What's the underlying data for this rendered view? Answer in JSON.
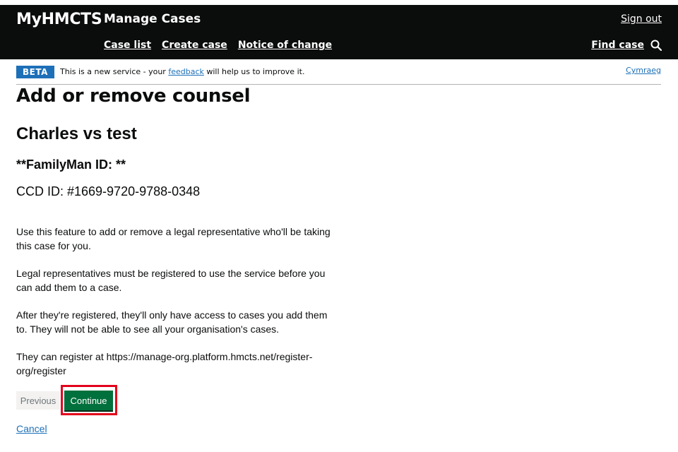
{
  "header": {
    "brand": "MyHMCTS",
    "service_name": "Manage Cases",
    "sign_out": "Sign out",
    "nav": [
      {
        "label": "Case list"
      },
      {
        "label": "Create case"
      },
      {
        "label": "Notice of change"
      }
    ],
    "find_case": "Find case",
    "find_case_icon": "search-icon"
  },
  "phase_banner": {
    "tag": "BETA",
    "text_before": "This is a new service - your ",
    "link": "feedback",
    "text_after": " will help us to improve it.",
    "language_link": "Cymraeg"
  },
  "main": {
    "title": "Add or remove counsel",
    "case_name": "Charles vs test",
    "familyman_id": "**FamilyMan ID: **",
    "ccd_id": "CCD ID: #1669-9720-9788-0348",
    "paragraphs": [
      "Use this feature to add or remove a legal representative who'll be taking this case for you.",
      "Legal representatives must be registered to use the service before you can add them to a case.",
      "After they're registered, they'll only have access to cases you add them to. They will not be able to see all your organisation's cases.",
      "They can register at https://manage-org.platform.hmcts.net/register-org/register"
    ],
    "previous_button": "Previous",
    "continue_button": "Continue",
    "cancel_link": "Cancel"
  },
  "colors": {
    "header_bg": "#0b0c0c",
    "link": "#1d70b8",
    "continue_bg": "#00703c",
    "highlight_border": "#e3001b",
    "beta_tag_bg": "#1d70b8"
  }
}
